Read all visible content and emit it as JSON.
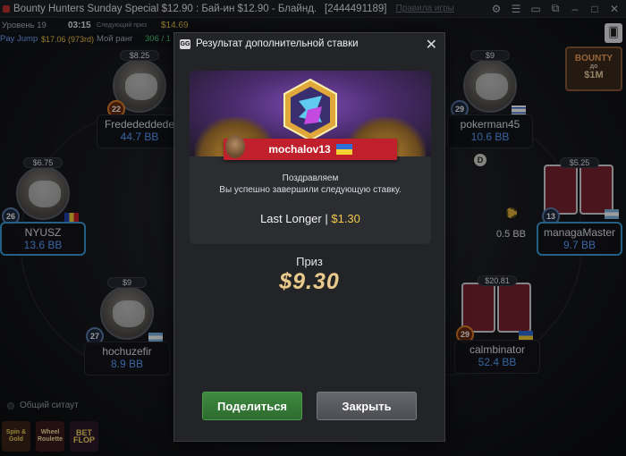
{
  "titlebar": {
    "title": "Bounty Hunters Sunday Special $12.90 : Бай-ин $12.90 - Блайнд...",
    "tournament_id": "[2444491189]",
    "rules_link": "Правила игры"
  },
  "info": {
    "level": "Уровень 19",
    "time": "03:15",
    "next_prize_label": "Следующий приз",
    "next_prize": "$14.69",
    "pay_jump": "Pay Jump",
    "pay_jump_value": "$17.06 (973rd)",
    "rank_label": "Мой ранг",
    "rank_value": "306 / 1"
  },
  "bounty_badge": {
    "line1": "BOUNTY",
    "line2": "до",
    "line3": "$1M"
  },
  "players": [
    {
      "bounty": "$8.25",
      "level": "22",
      "name": "Fredededdede",
      "stack": "44.7 BB"
    },
    {
      "bounty": "$6.75",
      "level": "26",
      "name": "NYUSZ",
      "stack": "13.6 BB"
    },
    {
      "bounty": "$9",
      "level": "27",
      "name": "hochuzefir",
      "stack": "8.9 BB"
    },
    {
      "bounty": "$9",
      "level": "29",
      "name": "pokerman45",
      "stack": "10.6 BB"
    },
    {
      "bounty": "$5.25",
      "level": "13",
      "name": "managaMaster",
      "stack": "9.7 BB"
    },
    {
      "bounty": "$20.81",
      "level": "29",
      "name": "calmbinator",
      "stack": "52.4 BB"
    }
  ],
  "bet_amount": "0.5 BB",
  "dealer": "D",
  "shared_label": "Общий ситаут",
  "games": [
    "Spin & Gold",
    "Wheel Roulette",
    "BET FLOP"
  ],
  "dialog": {
    "logo": "GG",
    "title": "Результат дополнительной ставки",
    "winner": "mochalov13",
    "congrats_1": "Поздравляем",
    "congrats_2": "Вы успешно завершили следующую ставку.",
    "bet_name": "Last Longer |",
    "bet_price": "$1.30",
    "prize_label": "Приз",
    "prize_value": "$9.30",
    "share_button": "Поделиться",
    "close_button": "Закрыть"
  },
  "colors": {
    "share_green": "#3f8a40",
    "close_gray": "#5a5c61",
    "gold": "#f2c94c",
    "ribbon_red": "#c0202c"
  }
}
